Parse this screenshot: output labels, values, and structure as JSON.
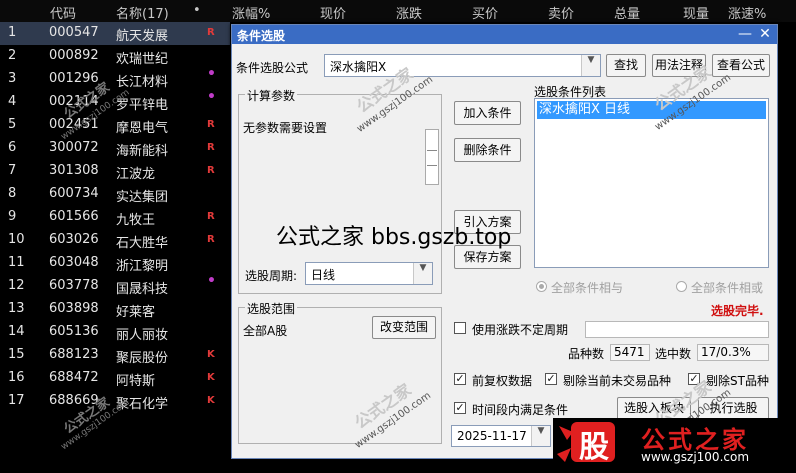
{
  "header": {
    "code": "代码",
    "name": "名称(17)",
    "dot": "•",
    "change_pct": "涨幅%",
    "price": "现价",
    "change": "涨跌",
    "bid": "买价",
    "ask": "卖价",
    "volume": "总量",
    "cur_volume": "现量",
    "speed": "涨速%"
  },
  "stocks": [
    {
      "n": "1",
      "code": "000547",
      "name": "航天发展",
      "mark": "R"
    },
    {
      "n": "2",
      "code": "000892",
      "name": "欢瑞世纪",
      "mark": ""
    },
    {
      "n": "3",
      "code": "001296",
      "name": "长江材料",
      "mark": "•"
    },
    {
      "n": "4",
      "code": "002114",
      "name": "罗平锌电",
      "mark": "•"
    },
    {
      "n": "5",
      "code": "002451",
      "name": "摩恩电气",
      "mark": "R"
    },
    {
      "n": "6",
      "code": "300072",
      "name": "海新能科",
      "mark": "R"
    },
    {
      "n": "7",
      "code": "301308",
      "name": "江波龙",
      "mark": "R"
    },
    {
      "n": "8",
      "code": "600734",
      "name": "实达集团",
      "mark": ""
    },
    {
      "n": "9",
      "code": "601566",
      "name": "九牧王",
      "mark": "R"
    },
    {
      "n": "10",
      "code": "603026",
      "name": "石大胜华",
      "mark": "R"
    },
    {
      "n": "11",
      "code": "603048",
      "name": "浙江黎明",
      "mark": ""
    },
    {
      "n": "12",
      "code": "603778",
      "name": "国晟科技",
      "mark": "•"
    },
    {
      "n": "13",
      "code": "603898",
      "name": "好莱客",
      "mark": ""
    },
    {
      "n": "14",
      "code": "605136",
      "name": "丽人丽妆",
      "mark": ""
    },
    {
      "n": "15",
      "code": "688123",
      "name": "聚辰股份",
      "mark": "K"
    },
    {
      "n": "16",
      "code": "688472",
      "name": "阿特斯",
      "mark": "K"
    },
    {
      "n": "17",
      "code": "688669",
      "name": "聚石化学",
      "mark": "K"
    }
  ],
  "dialog": {
    "title": "条件选股",
    "minimize": "—",
    "close": "✕",
    "formula_label": "条件选股公式",
    "formula_value": "深水擒阳X",
    "find_button": "查找",
    "usage_button": "用法注释",
    "view_button": "查看公式",
    "params_group": "计算参数",
    "params_text": "无参数需要设置",
    "add_condition": "加入条件",
    "remove_condition": "删除条件",
    "import_plan": "引入方案",
    "save_plan": "保存方案",
    "list_title": "选股条件列表",
    "list_items": [
      "深水擒阳X  日线"
    ],
    "period_label": "选股周期:",
    "period_value": "日线",
    "radio_and": "全部条件相与",
    "radio_or": "全部条件相或",
    "status": "选股完毕.",
    "range_group": "选股范围",
    "range_value": "全部A股",
    "change_range": "改变范围",
    "use_uncertain_period": "使用涨跌不定周期",
    "count_label": "品种数",
    "count_value": "5471",
    "hit_label": "选中数",
    "hit_value": "17/0.3%",
    "fq_label": "前复权数据",
    "remove_suspended": "剔除当前未交易品种",
    "remove_st": "剔除ST品种",
    "time_range_label": "时间段内满足条件",
    "date_value": "2025-11-17",
    "to_block": "选股入板块",
    "run_button": "执行选股"
  },
  "watermark": {
    "brand": "公式之家",
    "url": "www.gszj100.com",
    "site": "公式之家 bbs.gszb.top",
    "logo_char": "股",
    "logo_text": "公式之家",
    "logo_url": "www.gszj100.com"
  },
  "colors": {
    "accent": "#3a6cc4",
    "mark_red": "#e23a3a",
    "mark_purple": "#c03cc8",
    "status_red": "#d01010",
    "logo_red": "#e02020"
  }
}
